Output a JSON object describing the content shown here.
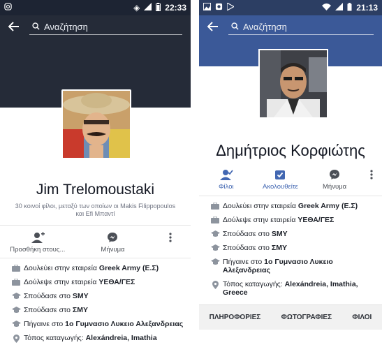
{
  "left": {
    "status": {
      "time": "22:33"
    },
    "search": {
      "placeholder": "Αναζήτηση"
    },
    "profile": {
      "name": "Jim Trelomoustaki",
      "mutual": "30 κοινοί φίλοι, μεταξύ των οποίων οι Makis Filippopoulos και Efi Μπαντί"
    },
    "actions": [
      {
        "label": "Προσθήκη στους..."
      },
      {
        "label": "Μήνυμα"
      }
    ],
    "info": [
      {
        "prefix": "Δουλεύει στην εταιρεία ",
        "value": "Greek Army (Ε.Σ)"
      },
      {
        "prefix": "Δούλεψε στην εταιρεία ",
        "value": "ΥΕΘΑ/ΓΕΣ"
      },
      {
        "prefix": "Σπούδασε στο ",
        "value": "SMY"
      },
      {
        "prefix": "Σπούδασε στο ",
        "value": "ΣΜΥ"
      },
      {
        "prefix": "Πήγαινε στο ",
        "value": "1ο Γυμνασιο Λυκειο Αλεξανδρειας"
      },
      {
        "prefix": "Τόπος καταγωγής: ",
        "value": "Alexándreia, Imathia"
      }
    ]
  },
  "right": {
    "status": {
      "time": "21:13"
    },
    "search": {
      "placeholder": "Αναζήτηση"
    },
    "profile": {
      "name": "Δημήτριος Κορφιώτης"
    },
    "actions": [
      {
        "label": "Φίλοι"
      },
      {
        "label": "Ακολουθείτε"
      },
      {
        "label": "Μήνυμα"
      }
    ],
    "info": [
      {
        "prefix": "Δουλεύει στην εταιρεία ",
        "value": "Greek Army (Ε.Σ)"
      },
      {
        "prefix": "Δούλεψε στην εταιρεία ",
        "value": "ΥΕΘΑ/ΓΕΣ"
      },
      {
        "prefix": "Σπούδασε στο ",
        "value": "SMY"
      },
      {
        "prefix": "Σπούδασε στο ",
        "value": "ΣΜΥ"
      },
      {
        "prefix": "Πήγαινε στο ",
        "value": "1ο Γυμνασιο Λυκειο Αλεξανδρειας"
      },
      {
        "prefix": "Τόπος καταγωγής: ",
        "value": "Alexándreia, Imathia, Greece"
      }
    ],
    "tabs": [
      "ΠΛΗΡΟΦΟΡΙΕΣ",
      "ΦΩΤΟΓΡΑΦΙΕΣ",
      "ΦΙΛΟΙ"
    ]
  },
  "colors": {
    "fb_blue": "#3b5998",
    "link_blue": "#4267b2",
    "dark_cover": "#252b38"
  }
}
